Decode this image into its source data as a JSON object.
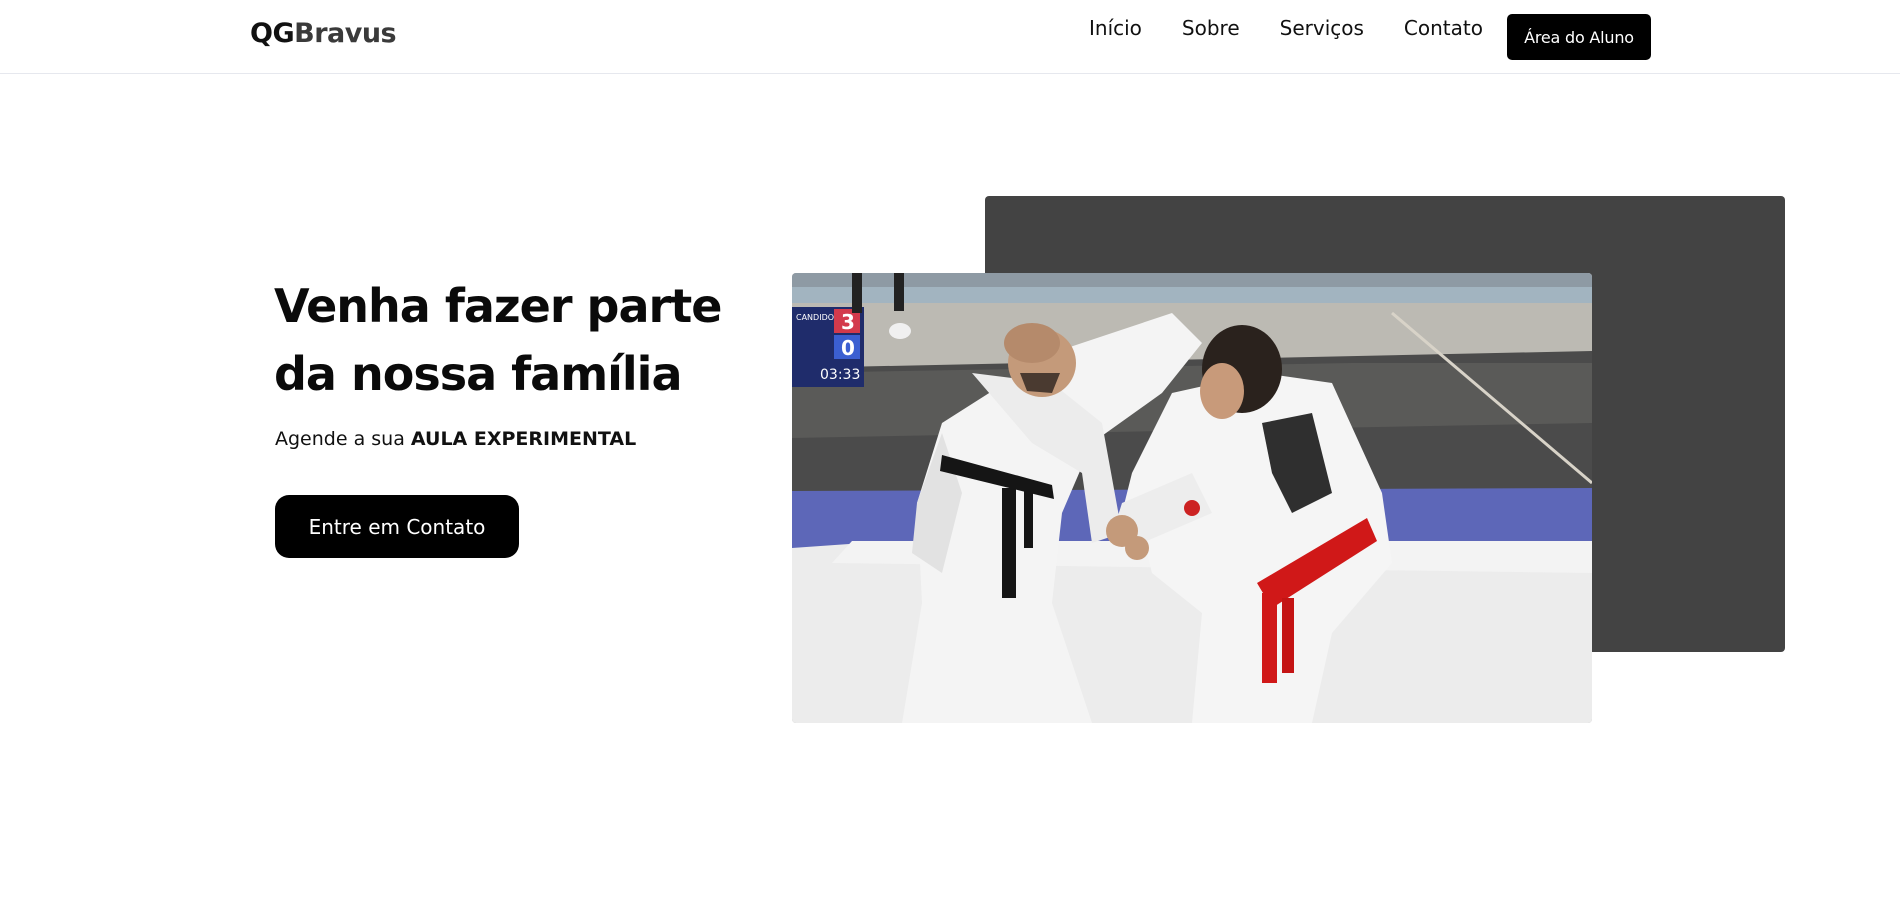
{
  "header": {
    "brand": {
      "part1": "QG",
      "part2": "Bravus"
    },
    "nav": [
      {
        "label": "Início"
      },
      {
        "label": "Sobre"
      },
      {
        "label": "Serviços"
      },
      {
        "label": "Contato"
      }
    ],
    "student_area_label": "Área do Aluno"
  },
  "hero": {
    "title_line1": "Venha fazer parte",
    "title_line2": "da nossa família",
    "subtitle_prefix": "Agende a sua ",
    "subtitle_emphasis": "AULA EXPERIMENTAL",
    "cta_label": "Entre em Contato",
    "scoreboard": {
      "name": "CANDIDO",
      "score_red": "3",
      "score_blue": "0",
      "time": "03:33"
    }
  },
  "colors": {
    "primary": "#000000",
    "backdrop": "#434343",
    "background": "#ffffff"
  }
}
